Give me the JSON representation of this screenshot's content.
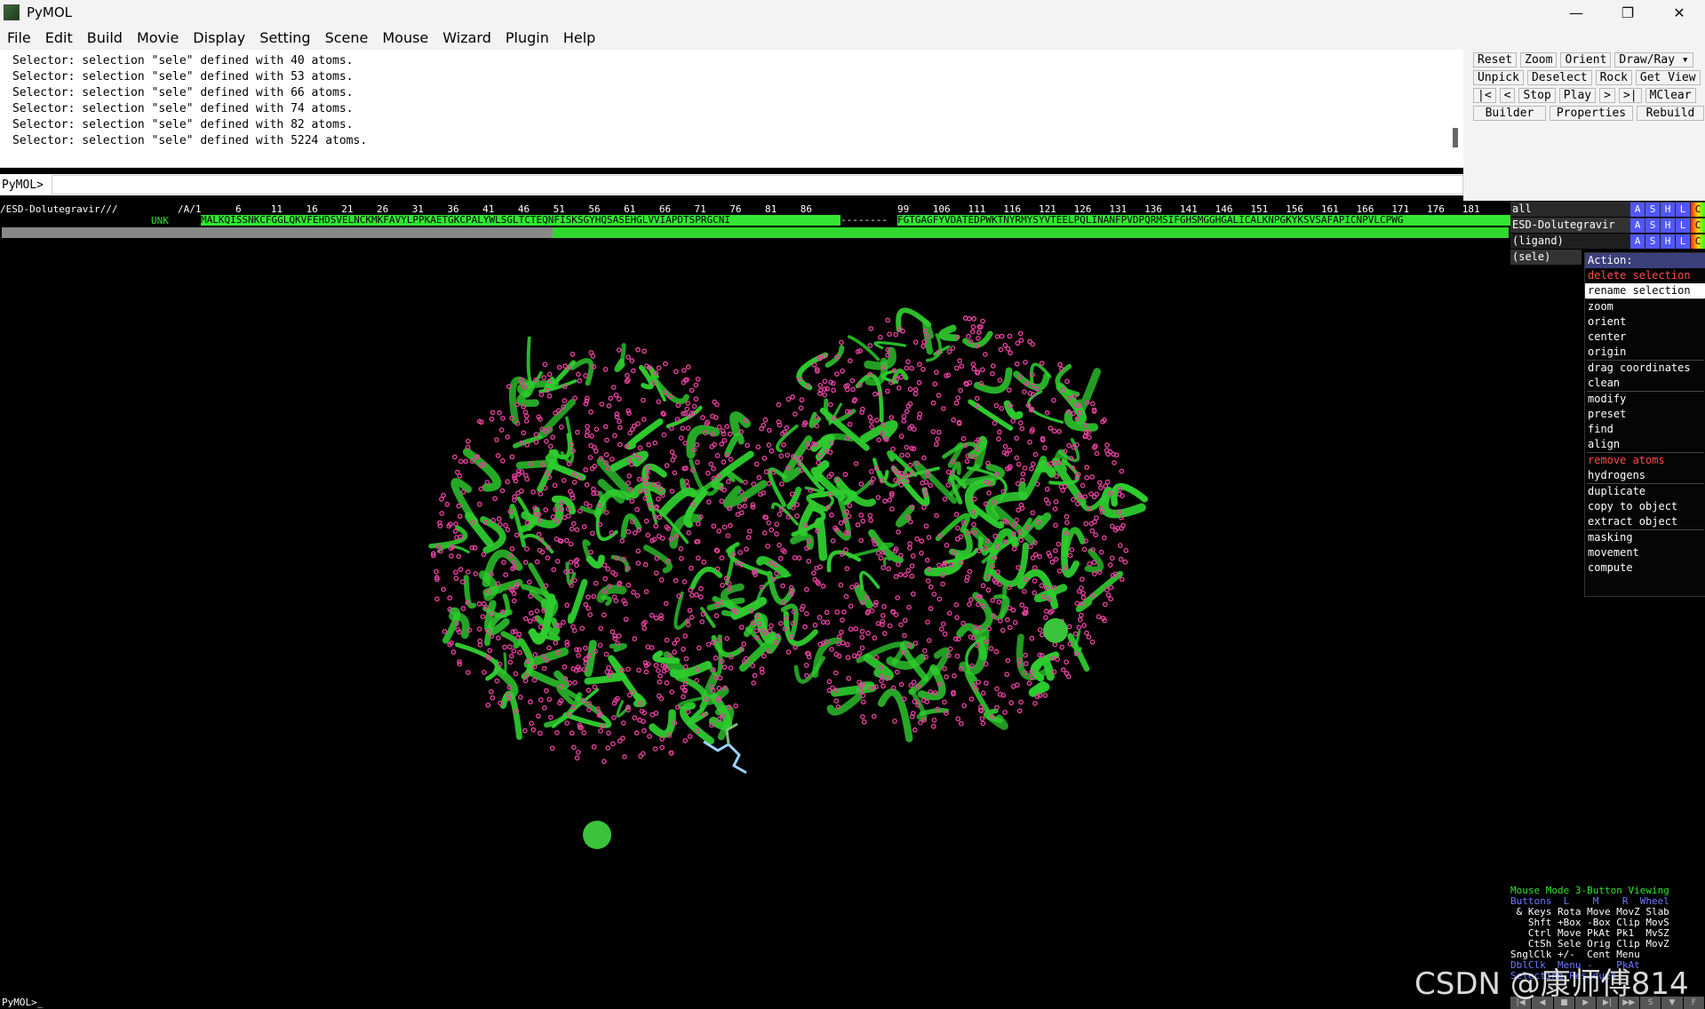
{
  "window": {
    "title": "PyMOL",
    "controls": {
      "minimize": "—",
      "restore": "❐",
      "close": "✕"
    }
  },
  "menubar": [
    "File",
    "Edit",
    "Build",
    "Movie",
    "Display",
    "Setting",
    "Scene",
    "Mouse",
    "Wizard",
    "Plugin",
    "Help"
  ],
  "console": {
    "lines": [
      "Selector: selection \"sele\" defined with 40 atoms.",
      "Selector: selection \"sele\" defined with 53 atoms.",
      "Selector: selection \"sele\" defined with 66 atoms.",
      "Selector: selection \"sele\" defined with 74 atoms.",
      "Selector: selection \"sele\" defined with 82 atoms.",
      "Selector: selection \"sele\" defined with 5224 atoms."
    ],
    "prompt": "PyMOL>",
    "bottom_prompt": "PyMOL>_"
  },
  "buttons": {
    "row1": [
      "Reset",
      "Zoom",
      "Orient",
      "Draw/Ray ▾"
    ],
    "row2": [
      "Unpick",
      "Deselect",
      "Rock",
      "Get View"
    ],
    "row3": [
      "|<",
      "<",
      "Stop",
      "Play",
      ">",
      ">|",
      "MClear"
    ],
    "row4": [
      "Builder",
      "Properties",
      "Rebuild"
    ]
  },
  "sequence": {
    "object_label": "/ESD-Dolutegravir///",
    "chain_label": "/A/1",
    "numbers": "6     11    16    21    26    31    36    41    46    51    56    61    66    71    76    81    86",
    "numbers2": "99    106   111   116   121   126   131   136   141   146   151   156   161   166   171   176   181",
    "unk_label": "UNK",
    "residues1": "MALKQISSNKCFGGLQKVFEHDSVELNCKMKFAVYLPPKAETGKCPALYWLSGLTCTEQNFISKSGYHQSASEHGLVVIAPDTSPRGCNI",
    "gap": "--------",
    "residues2": "FGTGAGFYVDATEDPWKTNYRMYSYVTEELPQLINANFPVDPQRMSIFGHSMGGHGALICALKNPGKYKSVSAFAPICNPVLCPWG"
  },
  "objects": [
    {
      "name": "all",
      "buttons": [
        "A",
        "S",
        "H",
        "L",
        "C"
      ]
    },
    {
      "name": "ESD-Dolutegravir",
      "buttons": [
        "A",
        "S",
        "H",
        "L",
        "C"
      ]
    },
    {
      "name": "(ligand)",
      "buttons": [
        "A",
        "S",
        "H",
        "L",
        "C"
      ]
    },
    {
      "name": "(sele)",
      "buttons": []
    }
  ],
  "action_menu": {
    "title": "Action:",
    "groups": [
      [
        {
          "label": "delete selection",
          "style": "red"
        },
        {
          "label": "rename selection",
          "style": "sel"
        }
      ],
      [
        {
          "label": "zoom"
        },
        {
          "label": "orient"
        },
        {
          "label": "center"
        },
        {
          "label": "origin"
        }
      ],
      [
        {
          "label": "drag coordinates"
        },
        {
          "label": "clean"
        }
      ],
      [
        {
          "label": "modify"
        },
        {
          "label": "preset"
        },
        {
          "label": "find"
        },
        {
          "label": "align"
        }
      ],
      [
        {
          "label": "remove atoms",
          "style": "red"
        },
        {
          "label": "hydrogens"
        }
      ],
      [
        {
          "label": "duplicate"
        },
        {
          "label": "copy to object"
        },
        {
          "label": "extract object"
        }
      ],
      [
        {
          "label": "masking"
        },
        {
          "label": "movement"
        },
        {
          "label": "compute"
        }
      ]
    ]
  },
  "mouse_panel": {
    "line1": "Mouse Mode 3-Button Viewing",
    "line2": "Buttons  L    M    R  Wheel",
    "line3": " & Keys Rota Move MovZ Slab",
    "line4": "   Shft +Box -Box Clip MovS",
    "line5": "   Ctrl Move PkAt Pk1  MvSZ",
    "line6": "   CtSh Sele Orig Clip MovZ",
    "line7": "SnglClk +/-  Cent Menu",
    "line8": "DblClk  Menu -    PkAt",
    "line9": "Selecting Residues"
  },
  "playbar": [
    "|◀",
    "◀",
    "■",
    "▶",
    "▶|",
    "▶▶",
    "S",
    "▼",
    "F"
  ],
  "watermark": "CSDN @康师傅814",
  "colors": {
    "cartoon": "#2ecc2e",
    "atoms": "#e0409a",
    "panel_bg": "#f3f3f3",
    "sequence": "#32e632",
    "action_title": "#3b3f7a"
  }
}
